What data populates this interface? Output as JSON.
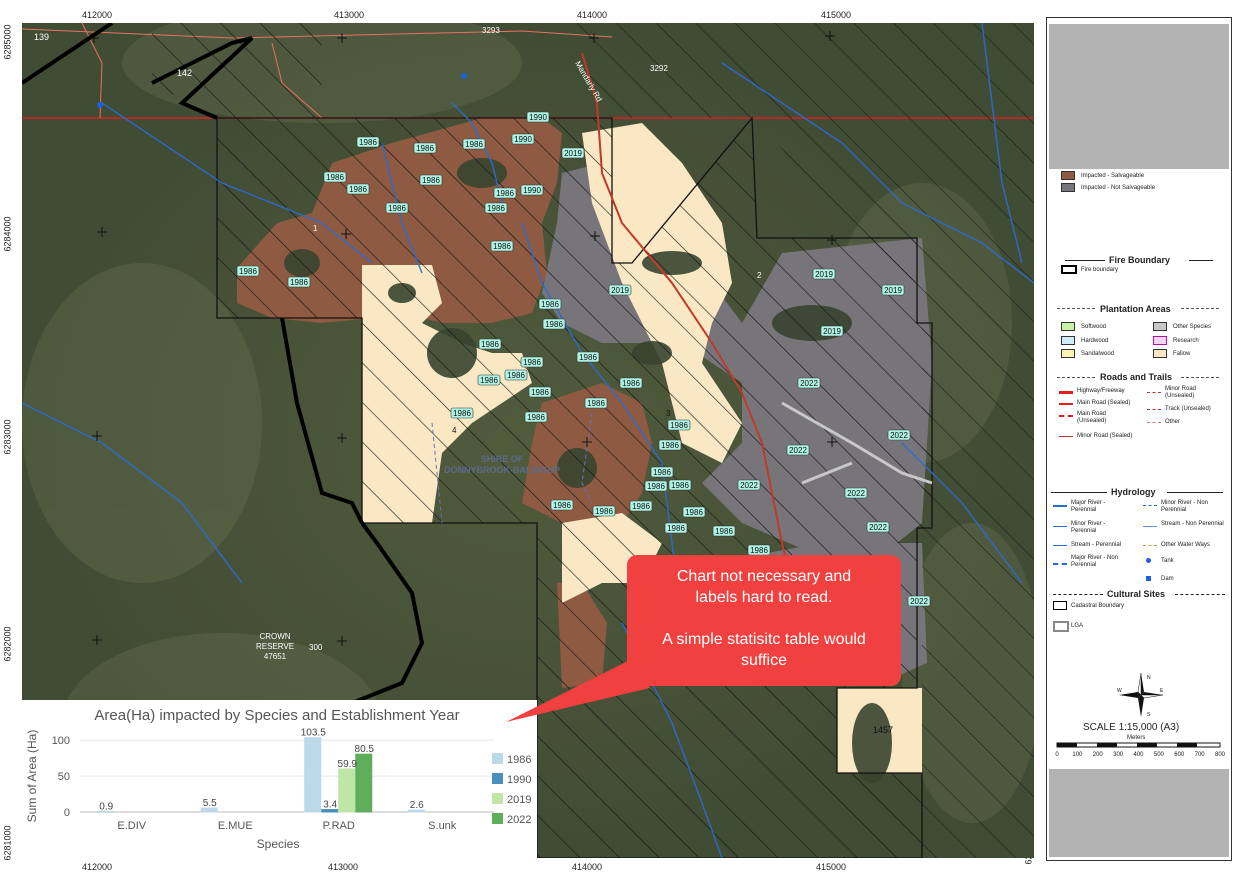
{
  "map": {
    "coords_top": [
      "412000",
      "413000",
      "414000",
      "415000"
    ],
    "coords_bottom": [
      "412000",
      "413000",
      "414000",
      "415000"
    ],
    "coords_left": [
      "6285000",
      "6284000",
      "6283000",
      "6282000",
      "6281000"
    ],
    "coords_right": [
      "6285000",
      "6284000",
      "6283000",
      "6282000",
      "6281000"
    ],
    "area_label_line1": "SHIRE OF",
    "area_label_line2": "DONNYBROOK-BALINGUP",
    "crown_line1": "CROWN",
    "crown_line2": "RESERVE",
    "crown_line3": "47651",
    "lot_labels": [
      "139",
      "142",
      "3293",
      "3292",
      "300",
      "1457",
      "1",
      "2",
      "3",
      "4"
    ],
    "road_label": "Mandarly Rd",
    "year_labels": [
      "1986",
      "1990",
      "2019",
      "2022"
    ]
  },
  "legend": {
    "impacted_salvageable": "Impacted - Salvageable",
    "impacted_not_salvageable": "Impacted - Not Salvageable",
    "fire_boundary_header": "Fire Boundary",
    "fire_boundary_item": "Fire boundary",
    "plantation_header": "Plantation Areas",
    "plantation_items": [
      "Softwood",
      "Other Species",
      "Hardwood",
      "Research",
      "Sandalwood",
      "Fallow"
    ],
    "roads_header": "Roads and Trails",
    "roads_items": [
      "Highway/Freeway",
      "Minor Road (Unsealed)",
      "Main Road (Sealed)",
      "Track (Unsealed)",
      "Main Road (Unsealed)",
      "Other",
      "Minor Road (Sealed)"
    ],
    "hydrology_header": "Hydrology",
    "hydrology_items": [
      "Major River - Perennial",
      "Minor River - Non Perennial",
      "Minor River - Perennial",
      "Stream - Non Perennial",
      "Stream - Perennial",
      "Other Water Ways",
      "Major River - Non Perennial",
      "Tank",
      "Dam"
    ],
    "cultural_header": "Cultural Sites",
    "cultural_items": [
      "Cadastral Boundary",
      "LGA"
    ],
    "scale_text": "SCALE   1:15,000   (A3)",
    "scale_unit": "Meters",
    "scale_ticks": [
      "0",
      "100",
      "200",
      "300",
      "400",
      "500",
      "600",
      "700",
      "800"
    ],
    "north_labels": [
      "N",
      "S",
      "E",
      "W"
    ]
  },
  "callout": {
    "line1": "Chart not necessary and",
    "line2": "labels hard to read.",
    "line3": "A simple statisitc table would",
    "line4": "suffice"
  },
  "chart_data": {
    "type": "bar",
    "title": "Area(Ha) impacted by Species and Establishment Year",
    "xlabel": "Species",
    "ylabel": "Sum of Area (Ha)",
    "categories": [
      "E.DIV",
      "E.MUE",
      "P.RAD",
      "S.unk"
    ],
    "ylim": [
      0,
      110
    ],
    "yticks": [
      0,
      50,
      100
    ],
    "series": [
      {
        "name": "1986",
        "color": "#bcd9ea",
        "values": [
          0.9,
          5.5,
          103.5,
          2.6
        ]
      },
      {
        "name": "1990",
        "color": "#4b8fbd",
        "values": [
          null,
          null,
          3.4,
          null
        ]
      },
      {
        "name": "2019",
        "color": "#bfe6a7",
        "values": [
          null,
          null,
          59.9,
          null
        ]
      },
      {
        "name": "2022",
        "color": "#5fae5c",
        "values": [
          null,
          null,
          80.5,
          null
        ]
      }
    ],
    "legend_position": "right"
  }
}
